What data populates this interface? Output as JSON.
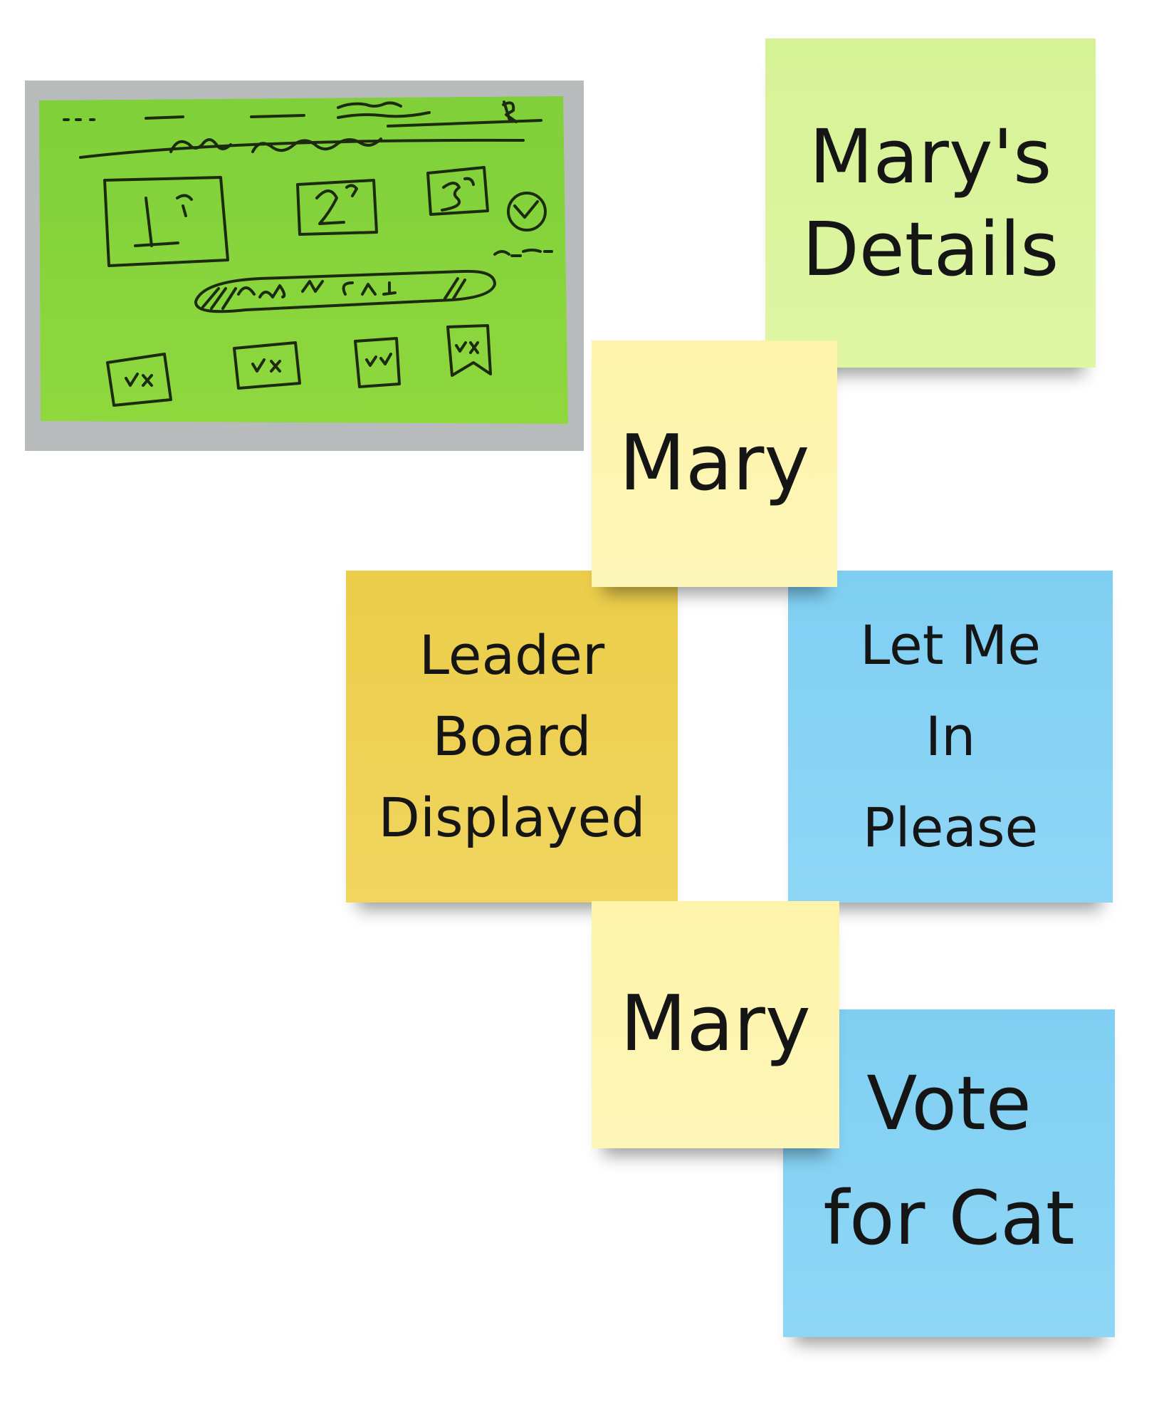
{
  "photo": {
    "description_icon": "hand-drawn-sketch-photo",
    "paper_color": "#88d63a",
    "handwriting": {
      "header": "REGISTER",
      "title": "TODAY'S TOURNAMENT",
      "places": [
        "1ST",
        "2ND",
        "3RD"
      ],
      "clock_label": "CLOCK",
      "button": "ADD MY CAT",
      "vote_marks": [
        "✓X",
        "✓X",
        "✓X",
        "✓X"
      ]
    }
  },
  "stickies": {
    "details": {
      "lines": [
        "Mary's",
        "Details"
      ],
      "color": "#dcf5a0"
    },
    "mary_top": {
      "lines": [
        "Mary"
      ],
      "color": "#fdf4b0"
    },
    "leader": {
      "lines": [
        "Leader",
        "Board",
        "Displayed"
      ],
      "color": "#eed257"
    },
    "letme": {
      "lines": [
        "Let Me",
        "In",
        "Please"
      ],
      "color": "#87d3f4"
    },
    "mary_bottom": {
      "lines": [
        "Mary"
      ],
      "color": "#fdf4b0"
    },
    "vote": {
      "lines": [
        "Vote",
        "for Cat"
      ],
      "color": "#87d3f4"
    }
  }
}
